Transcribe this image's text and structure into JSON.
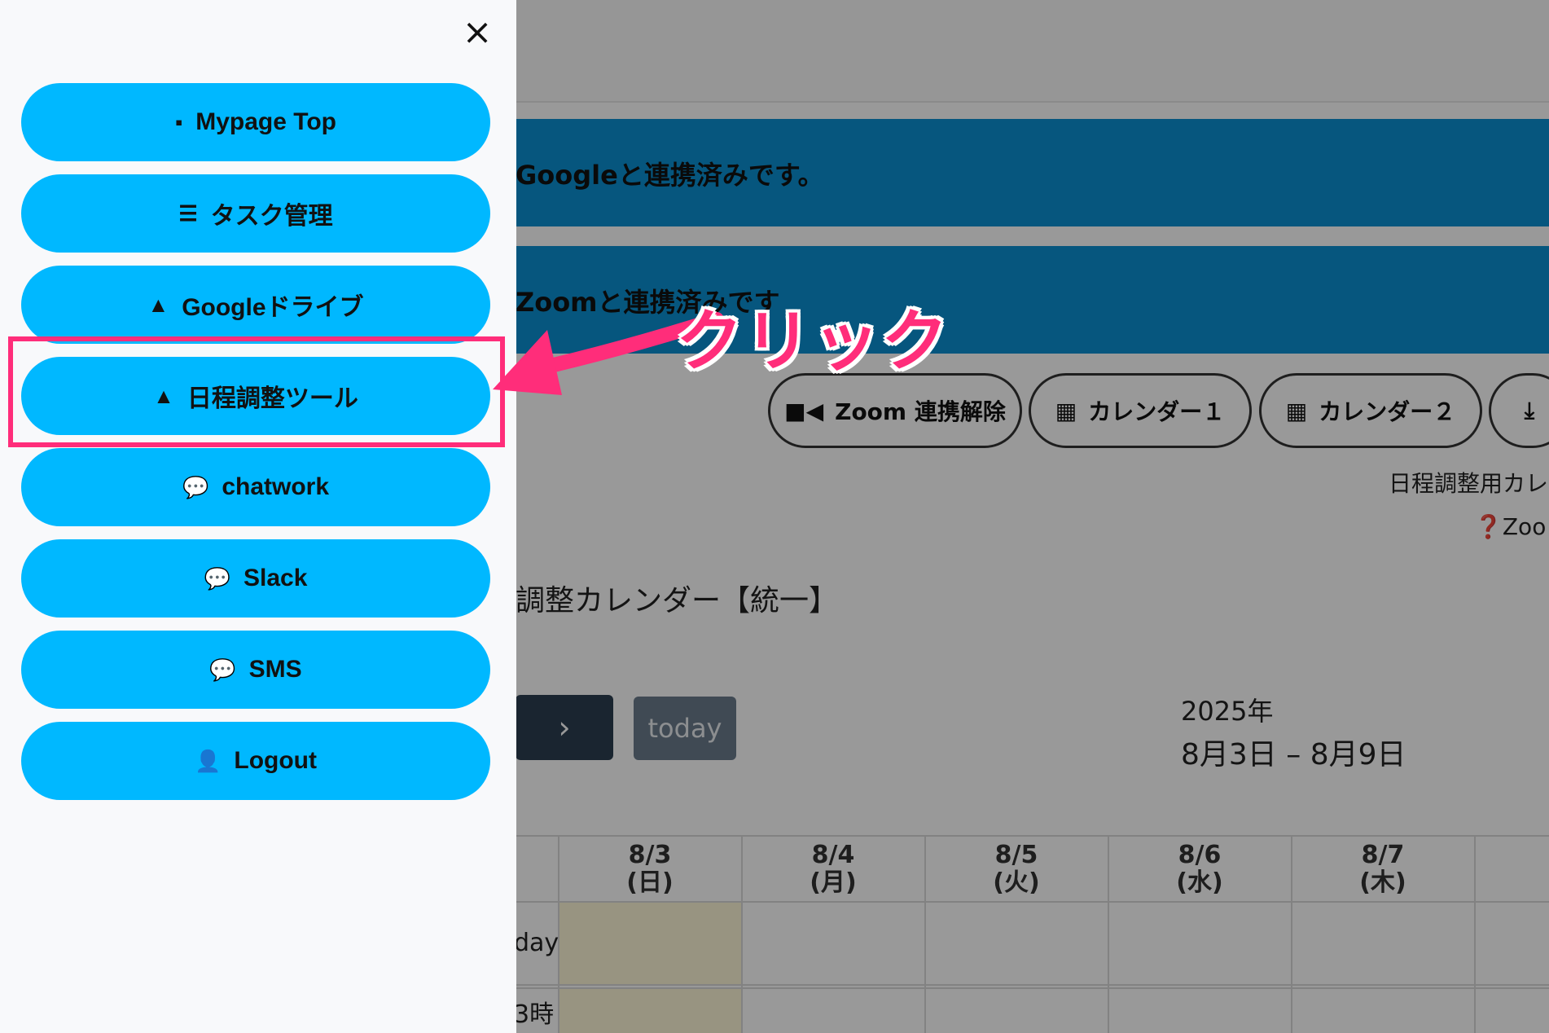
{
  "menu": {
    "close_icon": "×",
    "items": [
      {
        "label": "Mypage Top",
        "icon": "▪"
      },
      {
        "label": "タスク管理",
        "icon": "☰"
      },
      {
        "label": "Googleドライブ",
        "icon": "▲"
      },
      {
        "label": "日程調整ツール",
        "icon": "▲"
      },
      {
        "label": "chatwork",
        "icon": "💬"
      },
      {
        "label": "Slack",
        "icon": "💬"
      },
      {
        "label": "SMS",
        "icon": "💬"
      },
      {
        "label": "Logout",
        "icon": "👤"
      }
    ]
  },
  "background": {
    "google_banner": "Googleと連携済みです。",
    "zoom_banner": "Zoomと連携済みです",
    "actions": {
      "zoom": "Zoom 連携解除",
      "calendar1": "カレンダー１",
      "calendar2": "カレンダー２"
    },
    "note_calendar": "日程調整用カレ",
    "note_zoom": "Zoo",
    "calendar_title": "調整カレンダー【統一】",
    "today_button": "today",
    "next_icon": "›",
    "year": "2025年",
    "range": "8月3日 – 8月9日",
    "days": [
      {
        "date": "8/3",
        "weekday": "(日)"
      },
      {
        "date": "8/4",
        "weekday": "(月)"
      },
      {
        "date": "8/5",
        "weekday": "(火)"
      },
      {
        "date": "8/6",
        "weekday": "(水)"
      },
      {
        "date": "8/7",
        "weekday": "(木)"
      }
    ],
    "row_allday": "day",
    "row_time": "3時"
  },
  "annotation": {
    "callout": "クリック",
    "color": "#ff2d7a"
  }
}
